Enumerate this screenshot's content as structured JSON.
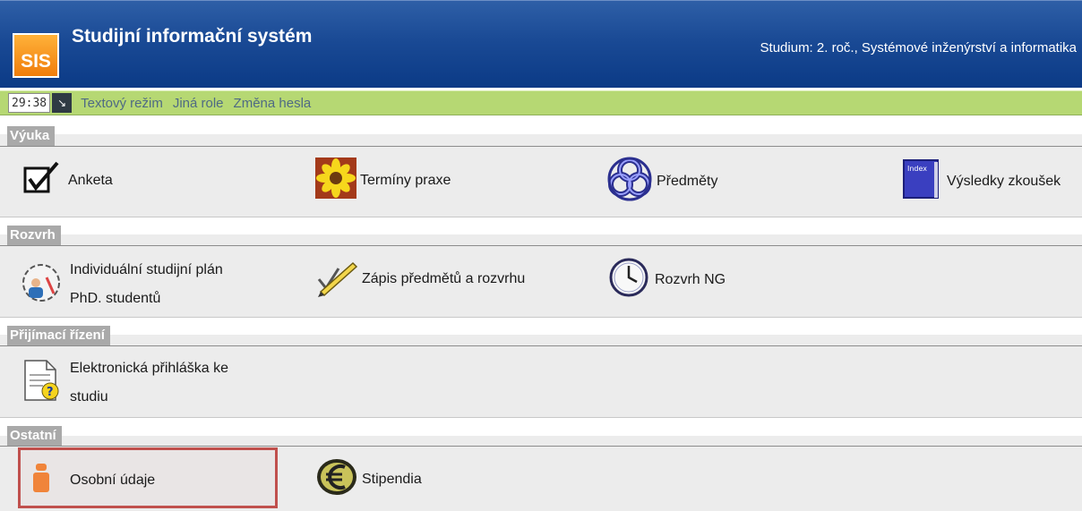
{
  "header": {
    "logo_text": "SIS",
    "title": "Studijní informační systém",
    "study_info": "Studium: 2. roč., Systémové inženýrství a informatika"
  },
  "toolbar": {
    "timer": "29:38",
    "links": [
      "Textový režim",
      "Jiná role",
      "Změna hesla"
    ]
  },
  "sections": {
    "vyuka": {
      "title": "Výuka",
      "items": [
        "Anketa",
        "Termíny praxe",
        "Předměty",
        "Výsledky zkoušek"
      ]
    },
    "rozvrh": {
      "title": "Rozvrh",
      "items": [
        "Individuální studijní plán PhD. studentů",
        "Zápis předmětů a rozvrhu",
        "Rozvrh NG"
      ],
      "item0_lines": [
        "Individuální studijní plán",
        "PhD. studentů"
      ]
    },
    "prijimaci": {
      "title": "Přijímací řízení",
      "item0_lines": [
        "Elektronická přihláška ke",
        "studiu"
      ]
    },
    "ostatni": {
      "title": "Ostatní",
      "items": [
        "Osobní údaje",
        "Stipendia"
      ]
    }
  },
  "icons": {
    "anketa": "checkbox-icon",
    "terminy": "sunflower-icon",
    "predmety": "celtic-knot-icon",
    "vysledky": "index-book-icon",
    "isp": "clock-person-icon",
    "zapis": "pencil-check-icon",
    "rozvrh_ng": "clock-icon",
    "prihlaska": "document-question-icon",
    "osobni": "person-icon",
    "stipendia": "euro-icon"
  },
  "colors": {
    "header_blue": "#1a4a95",
    "toolbar_green": "#b6d873",
    "section_gray": "#a9a9a9",
    "highlight_red": "#c0504d"
  }
}
